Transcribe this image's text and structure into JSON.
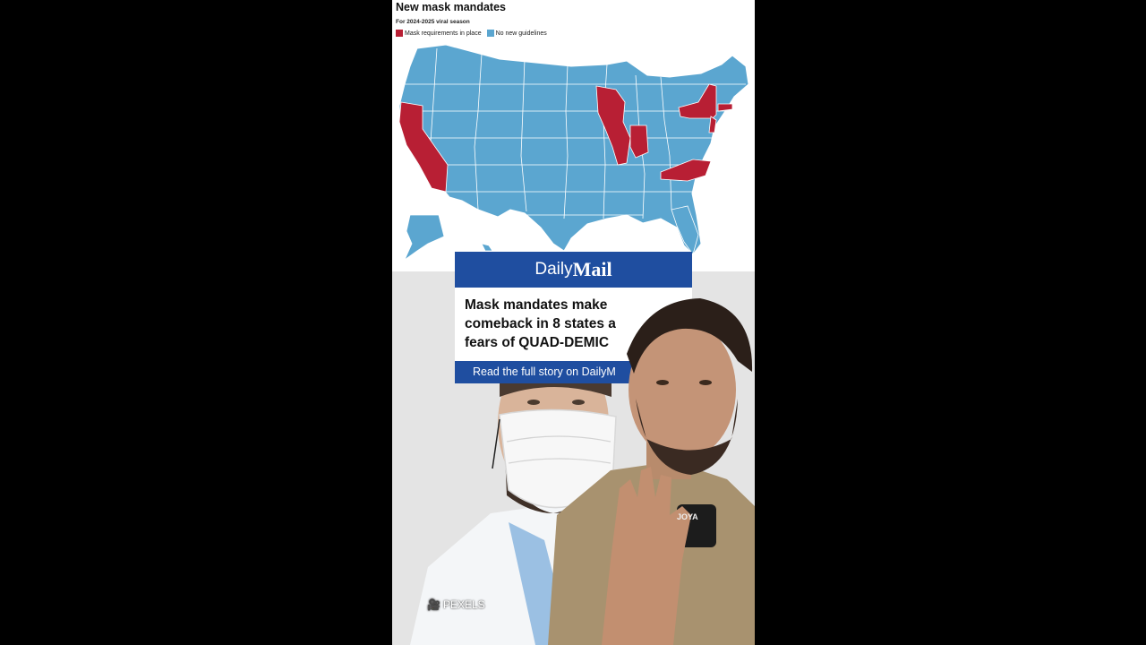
{
  "map": {
    "title": "New mask mandates",
    "subtitle": "For 2024-2025 viral season",
    "legend": [
      {
        "label": "Mask requirements in place",
        "color": "#b81f34"
      },
      {
        "label": "No new guidelines",
        "color": "#5ba6d0"
      }
    ]
  },
  "news_card": {
    "brand_light": "Daily",
    "brand_bold": "Mail",
    "headline_lines": [
      "Mask mandates make",
      "comeback in 8 states a",
      "fears of QUAD-DEMIC"
    ],
    "footer": "Read the full story on DailyM",
    "brand_color": "#1f4ea0"
  },
  "watermark": {
    "label": "PEXELS",
    "icon": "camera-icon"
  },
  "device_label": "JOYA"
}
